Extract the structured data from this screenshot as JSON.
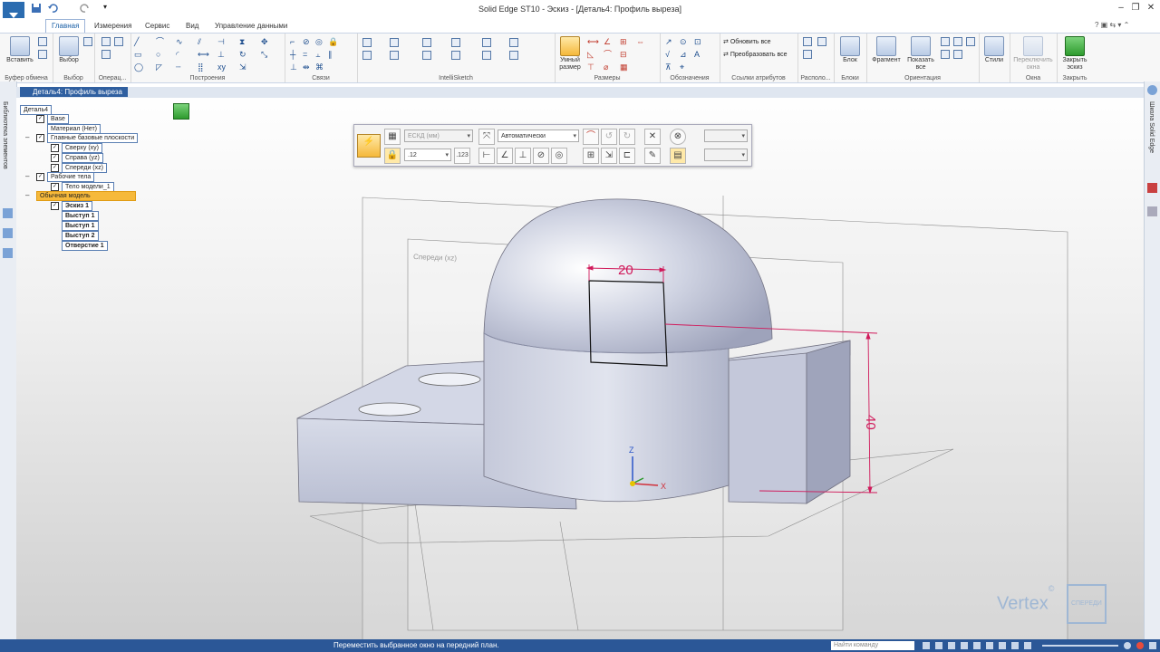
{
  "window": {
    "title": "Solid Edge ST10 - Эскиз - [Деталь4: Профиль выреза]"
  },
  "tabs": [
    {
      "label": "Главная",
      "active": true
    },
    {
      "label": "Измерения"
    },
    {
      "label": "Сервис"
    },
    {
      "label": "Вид"
    },
    {
      "label": "Управление данными"
    }
  ],
  "ribbon": {
    "clipboard": {
      "paste": "Вставить",
      "group": "Буфер обмена"
    },
    "select": {
      "select": "Выбор",
      "group": "Выбор"
    },
    "operations": {
      "group": "Операц..."
    },
    "draw": {
      "group": "Построения"
    },
    "relate": {
      "group": "Связи"
    },
    "intellisketch": {
      "group": "IntelliSketch"
    },
    "dimensions": {
      "smart": "Умный",
      "smart2": "размер",
      "group": "Размеры"
    },
    "annotation": {
      "group": "Обозначения"
    },
    "attrlinks": {
      "update_all": "Обновить все",
      "convert_all": "Преобразовать все",
      "group": "Ссылки атрибутов"
    },
    "layout": {
      "group": "Располо..."
    },
    "blocks": {
      "block": "Блок",
      "group": "Блоки"
    },
    "orient": {
      "fragment": "Фрагмент",
      "show_all": "Показать",
      "show_all2": "все",
      "group": "Ориентация"
    },
    "styles": {
      "label": "Стили"
    },
    "windows": {
      "switch": "Переключить",
      "switch2": "окна",
      "group": "Окна"
    },
    "close": {
      "label": "Закрыть",
      "label2": "эскиз",
      "group": "Закрыть"
    }
  },
  "document_tab": "Деталь4: Профиль выреза",
  "left_panel_label": "Библиотека элементов",
  "right_panel_label": "Школа Solid Edge",
  "tree": {
    "root": "Деталь4",
    "items": [
      {
        "label": "Base"
      },
      {
        "label": "Материал (Нет)"
      },
      {
        "label": "Главные базовые плоскости"
      },
      {
        "label": "Сверху (xy)"
      },
      {
        "label": "Справа (yz)"
      },
      {
        "label": "Спереди (xz)"
      },
      {
        "label": "Рабочие тела"
      },
      {
        "label": "Тело модели_1"
      },
      {
        "label": "Обычная модель"
      },
      {
        "label": "Эскиз 1"
      },
      {
        "label": "Выступ 1"
      },
      {
        "label": "Выступ 1"
      },
      {
        "label": "Выступ 2"
      },
      {
        "label": "Отверстие 1"
      }
    ]
  },
  "sketch_toolbar": {
    "standard": "ЕСКД (мм)",
    "mode": "Автоматически",
    "font_size": ".12"
  },
  "model": {
    "dim_width": "20",
    "dim_height": "40",
    "plane_front": "Спереди (xz)",
    "axis_x": "X",
    "axis_z": "Z"
  },
  "status": {
    "message": "Переместить выбранное окно на передний план.",
    "search_placeholder": "Найти команду"
  },
  "watermark": {
    "brand": "Vertex",
    "sub": "СПЕРЕДИ"
  }
}
